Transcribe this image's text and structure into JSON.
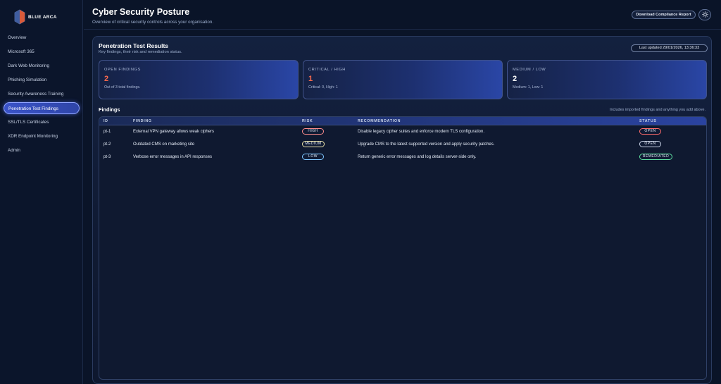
{
  "brand": {
    "name": "BLUE ARCA"
  },
  "sidebar": {
    "items": [
      {
        "label": "Overview"
      },
      {
        "label": "Microsoft 365"
      },
      {
        "label": "Dark Web Monitoring"
      },
      {
        "label": "Phishing Simulation"
      },
      {
        "label": "Security Awareness Training"
      },
      {
        "label": "Penetration Test Findings",
        "active": true
      },
      {
        "label": "SSL/TLS Certificates"
      },
      {
        "label": "XDR Endpoint Monitoring"
      },
      {
        "label": "Admin"
      }
    ]
  },
  "header": {
    "title": "Cyber Security Posture",
    "subtitle": "Overview of critical security controls across your organisation.",
    "report_button": "Download Compliance Report",
    "theme_icon": "sun-icon"
  },
  "panel": {
    "title": "Penetration Test Results",
    "subtitle": "Key findings, their risk and remediation status.",
    "last_updated": "Last updated 29/01/2026, 13:36:33"
  },
  "cards": [
    {
      "label": "OPEN FINDINGS",
      "value": "2",
      "note": "Out of 3 total findings."
    },
    {
      "label": "CRITICAL / HIGH",
      "value": "1",
      "note": "Critical: 0, High: 1"
    },
    {
      "label": "MEDIUM / LOW",
      "value": "2",
      "note": "Medium: 1, Low: 1"
    }
  ],
  "findings": {
    "title": "Findings",
    "note": "Includes imported findings and anything you add above.",
    "columns": [
      "ID",
      "FINDING",
      "RISK",
      "RECOMMENDATION",
      "STATUS"
    ],
    "rows": [
      {
        "id": "pt-1",
        "finding": "External VPN gateway allows weak ciphers",
        "risk": "HIGH",
        "recommendation": "Disable legacy cipher suites and enforce modern TLS configuration.",
        "status": "OPEN"
      },
      {
        "id": "pt-2",
        "finding": "Outdated CMS on marketing site",
        "risk": "MEDIUM",
        "recommendation": "Upgrade CMS to the latest supported version and apply security patches.",
        "status": "OPEN"
      },
      {
        "id": "pt-3",
        "finding": "Verbose error messages in API responses",
        "risk": "LOW",
        "recommendation": "Return generic error messages and log details server-side only.",
        "status": "REMEDIATED"
      }
    ]
  },
  "colors": {
    "background": "#0a1428",
    "accent": "#3a53c8",
    "danger": "#ff6b4e",
    "success": "#5ee0a0"
  }
}
